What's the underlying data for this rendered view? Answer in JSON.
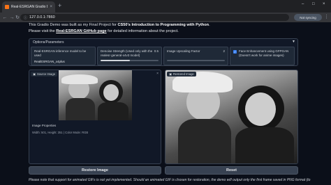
{
  "browser": {
    "tab_title": "Real-ESRGAN Gradio Demo",
    "tab_close": "×",
    "new_tab": "+",
    "window_controls": [
      "–",
      "□",
      "×"
    ],
    "nav": [
      "←",
      "→",
      "↻"
    ],
    "url": "127.0.0.1:7860",
    "sync_label": "Not syncing",
    "menu_icon": "⋮"
  },
  "intro": {
    "line1_prefix": "This Gradio Demo was built as my Final Project for ",
    "line1_bold": "CS50's Introduction to Programming with Python",
    "line1_suffix": ".",
    "line2_prefix": "Please visit the ",
    "line2_link": "Real-ESRGAN GitHub page",
    "line2_suffix": " for detailed information about the project."
  },
  "options": {
    "header": "Options/Parameters",
    "caret": "▼",
    "model_label": "Real-ESRGAN inference model to be used",
    "model_value": "RealESRGAN_x4plus",
    "denoise_label": "Denoise Strength (Used only with the realesr-general-x4v3 model)",
    "denoise_value": "0.5",
    "denoise_fraction": 0.5,
    "upscale_label": "Image Upscaling Factor",
    "upscale_value": "2",
    "upscale_fraction": 0.0,
    "face_label": "Face Enhancement using GFPGAN (Doesn't work for anime images)",
    "face_checked": true
  },
  "source": {
    "badge": "Source Image",
    "props_title": "Image Properties",
    "props_value": "Width: 501, Height: 351 | Color Mode: RGB"
  },
  "restored": {
    "badge": "Restored Image"
  },
  "buttons": {
    "restore": "Restore Image",
    "reset": "Reset"
  },
  "note": "Please note that support for animated GIFs is not yet implemented. Should an animated GIF is chosen for restoration, the demo will output only the first frame saved in PNG format (to"
}
